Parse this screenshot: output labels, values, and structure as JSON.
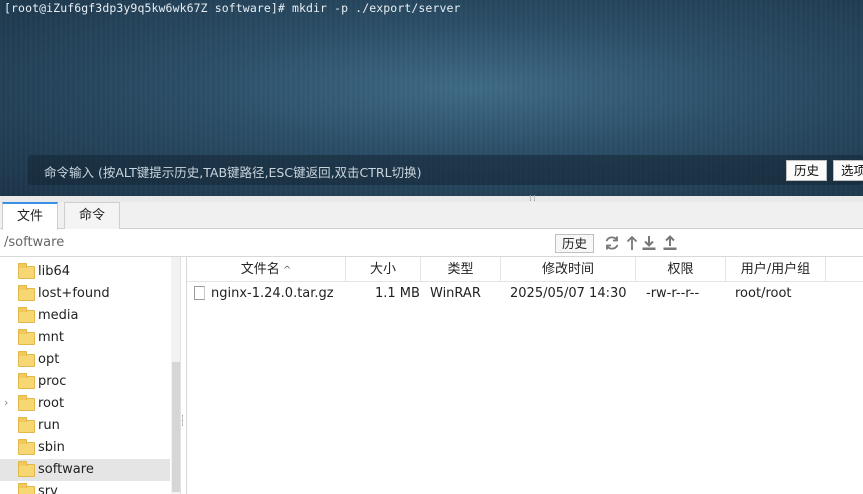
{
  "terminal": {
    "prompt_line": "[root@iZuf6gf3dp3y9q5kw6wk67Z software]# mkdir -p ./export/server",
    "input_placeholder": "命令输入 (按ALT键提示历史,TAB键路径,ESC键返回,双击CTRL切换)",
    "history_button": "历史",
    "options_button": "选项"
  },
  "tabs": [
    {
      "label": "文件",
      "active": true
    },
    {
      "label": "命令",
      "active": false
    }
  ],
  "pathbar": {
    "path": "/software",
    "history_button": "历史",
    "icons": [
      "refresh-icon",
      "up-arrow-icon",
      "download-icon",
      "upload-icon"
    ]
  },
  "tree": {
    "items": [
      {
        "name": "lib64",
        "expandable": false,
        "selected": false
      },
      {
        "name": "lost+found",
        "expandable": false,
        "selected": false
      },
      {
        "name": "media",
        "expandable": false,
        "selected": false
      },
      {
        "name": "mnt",
        "expandable": false,
        "selected": false
      },
      {
        "name": "opt",
        "expandable": false,
        "selected": false
      },
      {
        "name": "proc",
        "expandable": false,
        "selected": false
      },
      {
        "name": "root",
        "expandable": true,
        "selected": false
      },
      {
        "name": "run",
        "expandable": false,
        "selected": false
      },
      {
        "name": "sbin",
        "expandable": false,
        "selected": false
      },
      {
        "name": "software",
        "expandable": false,
        "selected": true
      },
      {
        "name": "srv",
        "expandable": false,
        "selected": false
      }
    ]
  },
  "file_table": {
    "columns": [
      "文件名",
      "大小",
      "类型",
      "修改时间",
      "权限",
      "用户/用户组"
    ],
    "sort_indicator": "^",
    "rows": [
      {
        "name": "nginx-1.24.0.tar.gz",
        "size": "1.1 MB",
        "type": "WinRAR",
        "modified": "2025/05/07 14:30",
        "permissions": "-rw-r--r--",
        "owner": "root/root"
      }
    ]
  },
  "colors": {
    "terminal_bg": "#2b4d66",
    "folder": "#f7d774",
    "accent": "#3a8ee6",
    "selected_row": "#e5e5e5"
  }
}
